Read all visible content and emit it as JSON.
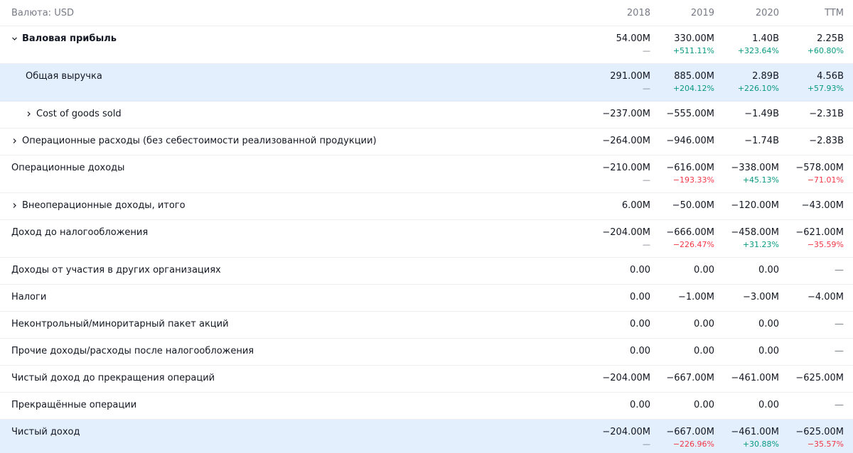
{
  "header": {
    "currency_label": "Валюта: USD",
    "columns": [
      "2018",
      "2019",
      "2020",
      "TTM"
    ]
  },
  "rows": [
    {
      "label": "Валовая прибыль",
      "values": [
        "54.00M",
        "330.00M",
        "1.40B",
        "2.25B"
      ],
      "changes": [
        "—",
        "+511.11%",
        "+323.64%",
        "+60.80%"
      ]
    },
    {
      "label": "Общая выручка",
      "values": [
        "291.00M",
        "885.00M",
        "2.89B",
        "4.56B"
      ],
      "changes": [
        "—",
        "+204.12%",
        "+226.10%",
        "+57.93%"
      ]
    },
    {
      "label": "Cost of goods sold",
      "values": [
        "−237.00M",
        "−555.00M",
        "−1.49B",
        "−2.31B"
      ]
    },
    {
      "label": "Операционные расходы (без себестоимости реализованной продукции)",
      "values": [
        "−264.00M",
        "−946.00M",
        "−1.74B",
        "−2.83B"
      ]
    },
    {
      "label": "Операционные доходы",
      "values": [
        "−210.00M",
        "−616.00M",
        "−338.00M",
        "−578.00M"
      ],
      "changes": [
        "—",
        "−193.33%",
        "+45.13%",
        "−71.01%"
      ]
    },
    {
      "label": "Внеоперационные доходы, итого",
      "values": [
        "6.00M",
        "−50.00M",
        "−120.00M",
        "−43.00M"
      ]
    },
    {
      "label": "Доход до налогообложения",
      "values": [
        "−204.00M",
        "−666.00M",
        "−458.00M",
        "−621.00M"
      ],
      "changes": [
        "—",
        "−226.47%",
        "+31.23%",
        "−35.59%"
      ]
    },
    {
      "label": "Доходы от участия в других организациях",
      "values": [
        "0.00",
        "0.00",
        "0.00",
        "—"
      ]
    },
    {
      "label": "Налоги",
      "values": [
        "0.00",
        "−1.00M",
        "−3.00M",
        "−4.00M"
      ]
    },
    {
      "label": "Неконтрольный/миноритарный пакет акций",
      "values": [
        "0.00",
        "0.00",
        "0.00",
        "—"
      ]
    },
    {
      "label": "Прочие доходы/расходы после налогообложения",
      "values": [
        "0.00",
        "0.00",
        "0.00",
        "—"
      ]
    },
    {
      "label": "Чистый доход до прекращения операций",
      "values": [
        "−204.00M",
        "−667.00M",
        "−461.00M",
        "−625.00M"
      ]
    },
    {
      "label": "Прекращённые операции",
      "values": [
        "0.00",
        "0.00",
        "0.00",
        "—"
      ]
    },
    {
      "label": "Чистый доход",
      "values": [
        "−204.00M",
        "−667.00M",
        "−461.00M",
        "−625.00M"
      ],
      "changes": [
        "—",
        "−226.96%",
        "+30.88%",
        "−35.57%"
      ]
    }
  ],
  "colors": {
    "positive": "#089981",
    "negative": "#f23645",
    "highlight_bg": "#e3effd",
    "muted": "#787b86"
  },
  "icons": {
    "expanded": "chevron-down-icon",
    "collapsed": "chevron-right-icon"
  }
}
